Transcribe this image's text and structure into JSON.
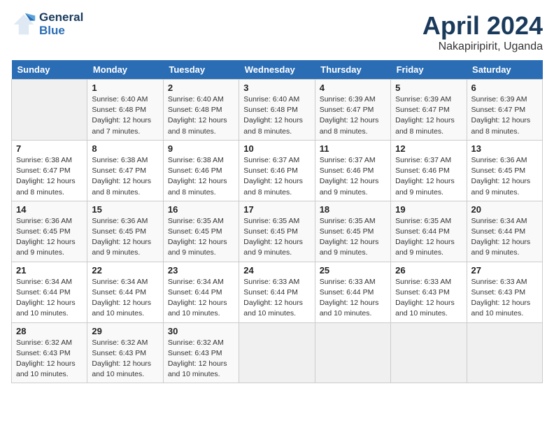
{
  "header": {
    "logo_line1": "General",
    "logo_line2": "Blue",
    "month": "April 2024",
    "location": "Nakapiripirit, Uganda"
  },
  "days_of_week": [
    "Sunday",
    "Monday",
    "Tuesday",
    "Wednesday",
    "Thursday",
    "Friday",
    "Saturday"
  ],
  "weeks": [
    [
      {
        "day": "",
        "sunrise": "",
        "sunset": "",
        "daylight": ""
      },
      {
        "day": "1",
        "sunrise": "Sunrise: 6:40 AM",
        "sunset": "Sunset: 6:48 PM",
        "daylight": "Daylight: 12 hours and 7 minutes."
      },
      {
        "day": "2",
        "sunrise": "Sunrise: 6:40 AM",
        "sunset": "Sunset: 6:48 PM",
        "daylight": "Daylight: 12 hours and 8 minutes."
      },
      {
        "day": "3",
        "sunrise": "Sunrise: 6:40 AM",
        "sunset": "Sunset: 6:48 PM",
        "daylight": "Daylight: 12 hours and 8 minutes."
      },
      {
        "day": "4",
        "sunrise": "Sunrise: 6:39 AM",
        "sunset": "Sunset: 6:47 PM",
        "daylight": "Daylight: 12 hours and 8 minutes."
      },
      {
        "day": "5",
        "sunrise": "Sunrise: 6:39 AM",
        "sunset": "Sunset: 6:47 PM",
        "daylight": "Daylight: 12 hours and 8 minutes."
      },
      {
        "day": "6",
        "sunrise": "Sunrise: 6:39 AM",
        "sunset": "Sunset: 6:47 PM",
        "daylight": "Daylight: 12 hours and 8 minutes."
      }
    ],
    [
      {
        "day": "7",
        "sunrise": "Sunrise: 6:38 AM",
        "sunset": "Sunset: 6:47 PM",
        "daylight": "Daylight: 12 hours and 8 minutes."
      },
      {
        "day": "8",
        "sunrise": "Sunrise: 6:38 AM",
        "sunset": "Sunset: 6:47 PM",
        "daylight": "Daylight: 12 hours and 8 minutes."
      },
      {
        "day": "9",
        "sunrise": "Sunrise: 6:38 AM",
        "sunset": "Sunset: 6:46 PM",
        "daylight": "Daylight: 12 hours and 8 minutes."
      },
      {
        "day": "10",
        "sunrise": "Sunrise: 6:37 AM",
        "sunset": "Sunset: 6:46 PM",
        "daylight": "Daylight: 12 hours and 8 minutes."
      },
      {
        "day": "11",
        "sunrise": "Sunrise: 6:37 AM",
        "sunset": "Sunset: 6:46 PM",
        "daylight": "Daylight: 12 hours and 9 minutes."
      },
      {
        "day": "12",
        "sunrise": "Sunrise: 6:37 AM",
        "sunset": "Sunset: 6:46 PM",
        "daylight": "Daylight: 12 hours and 9 minutes."
      },
      {
        "day": "13",
        "sunrise": "Sunrise: 6:36 AM",
        "sunset": "Sunset: 6:45 PM",
        "daylight": "Daylight: 12 hours and 9 minutes."
      }
    ],
    [
      {
        "day": "14",
        "sunrise": "Sunrise: 6:36 AM",
        "sunset": "Sunset: 6:45 PM",
        "daylight": "Daylight: 12 hours and 9 minutes."
      },
      {
        "day": "15",
        "sunrise": "Sunrise: 6:36 AM",
        "sunset": "Sunset: 6:45 PM",
        "daylight": "Daylight: 12 hours and 9 minutes."
      },
      {
        "day": "16",
        "sunrise": "Sunrise: 6:35 AM",
        "sunset": "Sunset: 6:45 PM",
        "daylight": "Daylight: 12 hours and 9 minutes."
      },
      {
        "day": "17",
        "sunrise": "Sunrise: 6:35 AM",
        "sunset": "Sunset: 6:45 PM",
        "daylight": "Daylight: 12 hours and 9 minutes."
      },
      {
        "day": "18",
        "sunrise": "Sunrise: 6:35 AM",
        "sunset": "Sunset: 6:45 PM",
        "daylight": "Daylight: 12 hours and 9 minutes."
      },
      {
        "day": "19",
        "sunrise": "Sunrise: 6:35 AM",
        "sunset": "Sunset: 6:44 PM",
        "daylight": "Daylight: 12 hours and 9 minutes."
      },
      {
        "day": "20",
        "sunrise": "Sunrise: 6:34 AM",
        "sunset": "Sunset: 6:44 PM",
        "daylight": "Daylight: 12 hours and 9 minutes."
      }
    ],
    [
      {
        "day": "21",
        "sunrise": "Sunrise: 6:34 AM",
        "sunset": "Sunset: 6:44 PM",
        "daylight": "Daylight: 12 hours and 10 minutes."
      },
      {
        "day": "22",
        "sunrise": "Sunrise: 6:34 AM",
        "sunset": "Sunset: 6:44 PM",
        "daylight": "Daylight: 12 hours and 10 minutes."
      },
      {
        "day": "23",
        "sunrise": "Sunrise: 6:34 AM",
        "sunset": "Sunset: 6:44 PM",
        "daylight": "Daylight: 12 hours and 10 minutes."
      },
      {
        "day": "24",
        "sunrise": "Sunrise: 6:33 AM",
        "sunset": "Sunset: 6:44 PM",
        "daylight": "Daylight: 12 hours and 10 minutes."
      },
      {
        "day": "25",
        "sunrise": "Sunrise: 6:33 AM",
        "sunset": "Sunset: 6:44 PM",
        "daylight": "Daylight: 12 hours and 10 minutes."
      },
      {
        "day": "26",
        "sunrise": "Sunrise: 6:33 AM",
        "sunset": "Sunset: 6:43 PM",
        "daylight": "Daylight: 12 hours and 10 minutes."
      },
      {
        "day": "27",
        "sunrise": "Sunrise: 6:33 AM",
        "sunset": "Sunset: 6:43 PM",
        "daylight": "Daylight: 12 hours and 10 minutes."
      }
    ],
    [
      {
        "day": "28",
        "sunrise": "Sunrise: 6:32 AM",
        "sunset": "Sunset: 6:43 PM",
        "daylight": "Daylight: 12 hours and 10 minutes."
      },
      {
        "day": "29",
        "sunrise": "Sunrise: 6:32 AM",
        "sunset": "Sunset: 6:43 PM",
        "daylight": "Daylight: 12 hours and 10 minutes."
      },
      {
        "day": "30",
        "sunrise": "Sunrise: 6:32 AM",
        "sunset": "Sunset: 6:43 PM",
        "daylight": "Daylight: 12 hours and 10 minutes."
      },
      {
        "day": "",
        "sunrise": "",
        "sunset": "",
        "daylight": ""
      },
      {
        "day": "",
        "sunrise": "",
        "sunset": "",
        "daylight": ""
      },
      {
        "day": "",
        "sunrise": "",
        "sunset": "",
        "daylight": ""
      },
      {
        "day": "",
        "sunrise": "",
        "sunset": "",
        "daylight": ""
      }
    ]
  ]
}
